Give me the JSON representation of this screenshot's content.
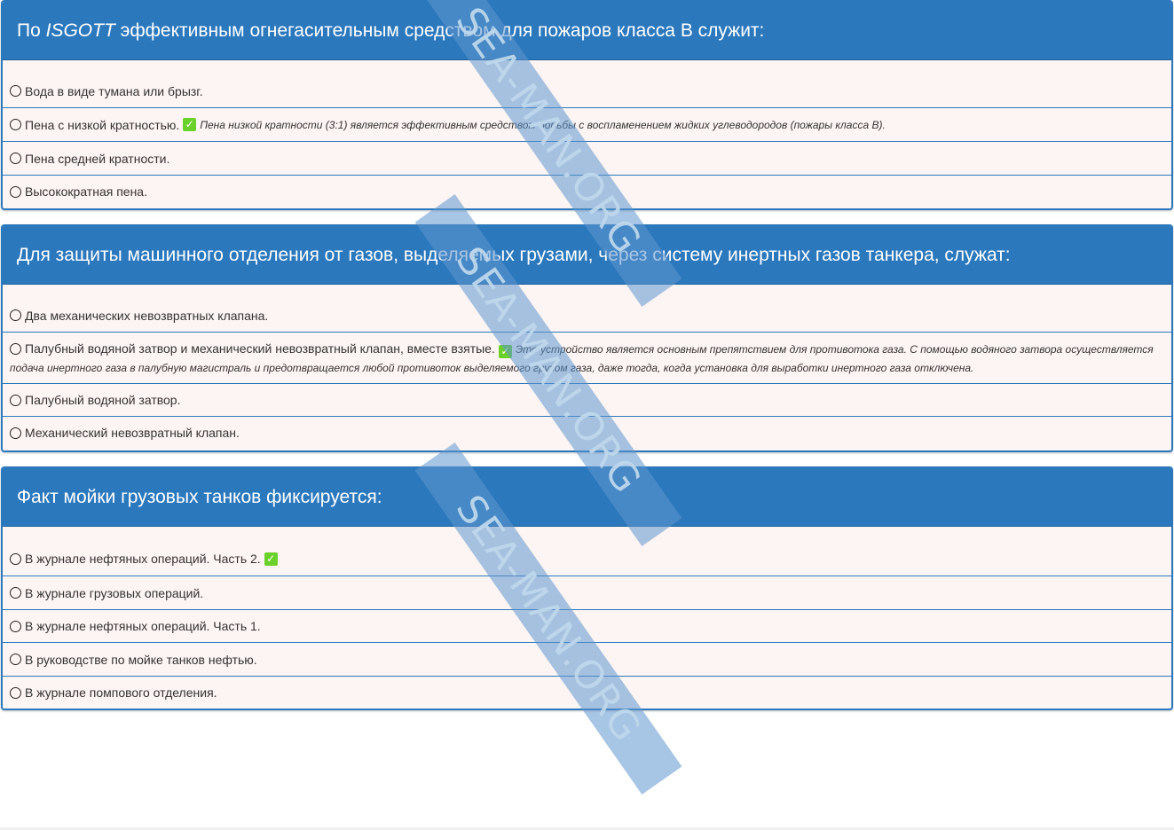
{
  "questions": [
    {
      "title_prefix": "По ",
      "title_italic": "ISGOTT",
      "title_rest": " эффективным огнегасительным средством для пожаров класса В служит:",
      "answers": [
        {
          "text": "Вода в виде тумана или брызг."
        },
        {
          "text": "Пена с низкой кратностью.",
          "correct": true,
          "explanation": "Пена низкой кратности (3:1) является эффективным средством борьбы с воспламенением жидких углеводородов (пожары класса В)."
        },
        {
          "text": "Пена средней кратности."
        },
        {
          "text": "Высокократная пена."
        }
      ]
    },
    {
      "title": "Для защиты машинного отделения от газов, выделяемых грузами, через систему инертных газов танкера, служат:",
      "answers": [
        {
          "text": "Два механических невозвратных клапана."
        },
        {
          "text": "Палубный водяной затвор и механический невозвратный клапан, вместе взятые.",
          "correct": true,
          "explanation": "Это устройство является основным препятствием для противотока газа. С помощью водяного затвора осуществляется подача инертного газа в палубную магистраль и предотвращается любой противоток выделяемого грузом газа, даже тогда, когда установка для выработки инертного газа отключена."
        },
        {
          "text": "Палубный водяной затвор."
        },
        {
          "text": "Механический невозвратный клапан."
        }
      ]
    },
    {
      "title": "Факт мойки грузовых танков фиксируется:",
      "answers": [
        {
          "text": "В журнале нефтяных операций. Часть 2.",
          "correct": true
        },
        {
          "text": "В журнале грузовых операций."
        },
        {
          "text": "В журнале нефтяных операций. Часть 1."
        },
        {
          "text": "В руководстве по мойке танков нефтью."
        },
        {
          "text": "В журнале помпового отделения."
        }
      ]
    }
  ],
  "watermark": "SEA-MAN.ORG",
  "check_icon": "✓",
  "colors": {
    "header": "#2b78bd",
    "row_bg": "#fdf5f3",
    "check": "#6ad12a"
  }
}
